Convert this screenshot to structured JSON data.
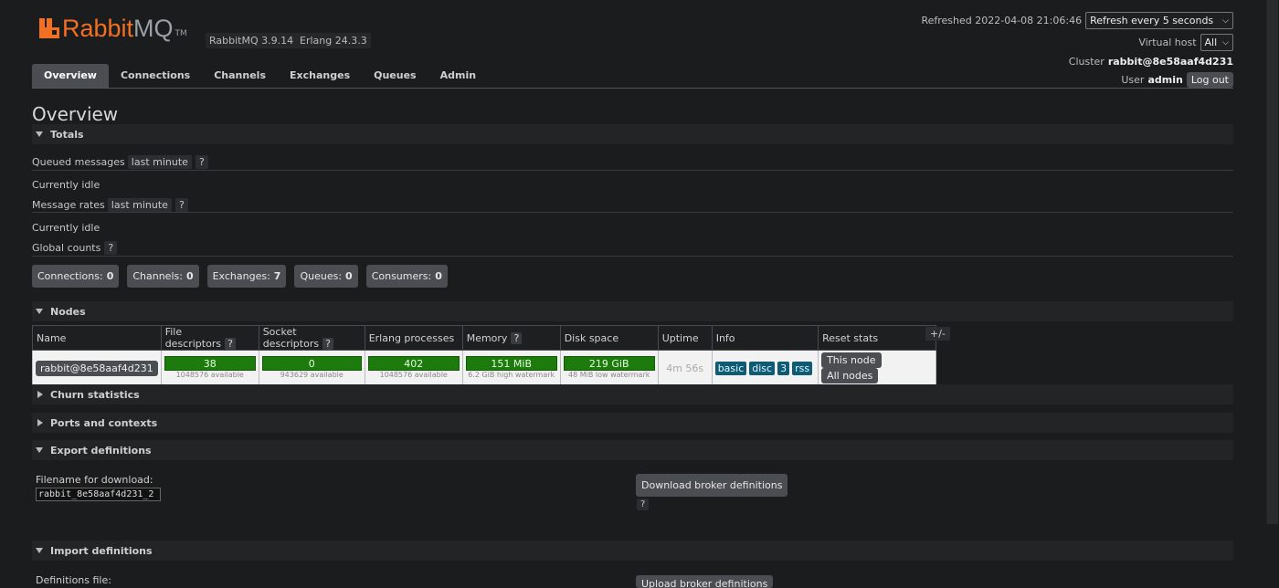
{
  "header": {
    "logo_rabbit": "Rabbit",
    "logo_mq": "MQ",
    "logo_tm": "TM",
    "rabbitmq_version": "RabbitMQ 3.9.14",
    "erlang_version": "Erlang 24.3.3",
    "refreshed_label": "Refreshed 2022-04-08 21:06:46",
    "refresh_select": "Refresh every 5 seconds",
    "virtual_host_label": "Virtual host",
    "virtual_host_value": "All",
    "cluster_label": "Cluster",
    "cluster_value": "rabbit@8e58aaf4d231",
    "user_label": "User",
    "user_value": "admin",
    "logout_label": "Log out"
  },
  "tabs": [
    {
      "label": "Overview",
      "active": true
    },
    {
      "label": "Connections"
    },
    {
      "label": "Channels"
    },
    {
      "label": "Exchanges"
    },
    {
      "label": "Queues"
    },
    {
      "label": "Admin"
    }
  ],
  "page_title": "Overview",
  "totals": {
    "header": "Totals",
    "queued_label": "Queued messages",
    "queued_range": "last minute",
    "currently_idle_1": "Currently idle",
    "rates_label": "Message rates",
    "rates_range": "last minute",
    "currently_idle_2": "Currently idle",
    "global_counts_label": "Global counts",
    "help": "?"
  },
  "counts": [
    {
      "label": "Connections:",
      "value": "0"
    },
    {
      "label": "Channels:",
      "value": "0"
    },
    {
      "label": "Exchanges:",
      "value": "7"
    },
    {
      "label": "Queues:",
      "value": "0"
    },
    {
      "label": "Consumers:",
      "value": "0"
    }
  ],
  "nodes": {
    "header": "Nodes",
    "columns": [
      "Name",
      "File descriptors",
      "Socket descriptors",
      "Erlang processes",
      "Memory",
      "Disk space",
      "Uptime",
      "Info",
      "Reset stats"
    ],
    "plus_minus": "+/-",
    "row": {
      "name": "rabbit@8e58aaf4d231",
      "file_desc": "38",
      "file_desc_sub": "1048576 available",
      "socket_desc": "0",
      "socket_desc_sub": "943629 available",
      "erlang_proc": "402",
      "erlang_proc_sub": "1048576 available",
      "memory": "151 MiB",
      "memory_sub": "6.2 GiB high watermark",
      "disk": "219 GiB",
      "disk_sub": "48 MiB low watermark",
      "uptime": "4m 56s",
      "info_tags": [
        "basic",
        "disc",
        "3",
        "rss"
      ],
      "reset_this": "This node",
      "reset_all": "All nodes"
    }
  },
  "sections": {
    "churn": "Churn statistics",
    "ports": "Ports and contexts",
    "export": "Export definitions",
    "import": "Import definitions"
  },
  "export": {
    "filename_label": "Filename for download:",
    "filename_value": "rabbit_8e58aaf4d231_2",
    "download_btn": "Download broker definitions"
  },
  "import": {
    "file_label": "Definitions file:",
    "upload_btn": "Upload broker definitions"
  }
}
